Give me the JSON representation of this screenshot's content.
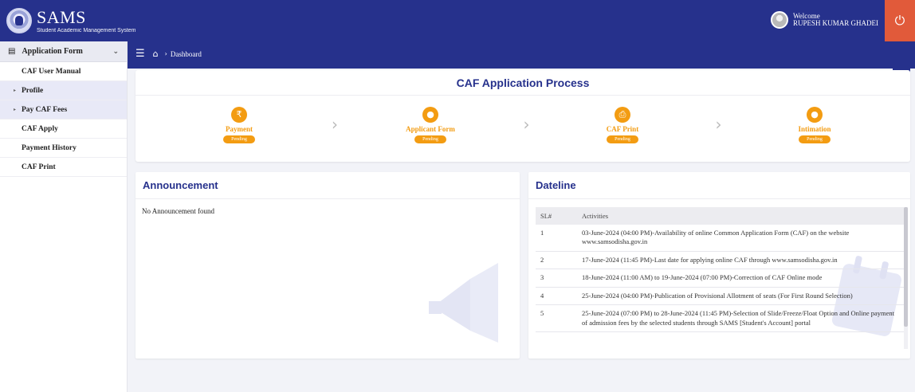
{
  "header": {
    "brand_name": "SAMS",
    "brand_sub": "Student Academic Management System",
    "welcome": "Welcome",
    "user_name": "RUPESH KUMAR GHADEI",
    "logout_icon": "⏻"
  },
  "sidebar": {
    "head_label": "Application Form",
    "items": [
      {
        "label": "CAF User Manual",
        "tint": false,
        "arrow": false
      },
      {
        "label": "Profile",
        "tint": true,
        "arrow": true
      },
      {
        "label": "Pay CAF Fees",
        "tint": true,
        "arrow": true
      },
      {
        "label": "CAF Apply",
        "tint": false,
        "arrow": false
      },
      {
        "label": "Payment History",
        "tint": false,
        "arrow": false
      },
      {
        "label": "CAF Print",
        "tint": false,
        "arrow": false
      }
    ]
  },
  "breadcrumb": {
    "current": "Dashboard"
  },
  "process": {
    "title": "CAF Application Process",
    "steps": [
      {
        "label": "Payment",
        "status": "Pending",
        "icon": "₹"
      },
      {
        "label": "Applicant Form",
        "status": "Pending",
        "icon": "●"
      },
      {
        "label": "CAF Print",
        "status": "Pending",
        "icon": "⎙"
      },
      {
        "label": "Intimation",
        "status": "Pending",
        "icon": "●"
      }
    ]
  },
  "announcement": {
    "title": "Announcement",
    "empty_text": "No Announcement found"
  },
  "dateline": {
    "title": "Dateline",
    "col_sl": "SL#",
    "col_activities": "Activities",
    "rows": [
      {
        "sl": "1",
        "text": "03-June-2024 (04:00 PM)-Availability of online Common Application Form (CAF) on the website www.samsodisha.gov.in"
      },
      {
        "sl": "2",
        "text": "17-June-2024 (11:45 PM)-Last date for applying online CAF through www.samsodisha.gov.in"
      },
      {
        "sl": "3",
        "text": "18-June-2024 (11:00 AM) to 19-June-2024 (07:00 PM)-Correction of CAF Online mode"
      },
      {
        "sl": "4",
        "text": "25-June-2024 (04:00 PM)-Publication of Provisional Allotment of seats (For First Round Selection)"
      },
      {
        "sl": "5",
        "text": "25-June-2024 (07:00 PM) to 28-June-2024 (11:45 PM)-Selection of Slide/Freeze/Float Option and Online payment of admission fees by the selected students through SAMS [Student's Account] portal"
      }
    ]
  },
  "colors": {
    "primary": "#26318c",
    "accent": "#f39c12",
    "logout": "#e15a3a"
  }
}
